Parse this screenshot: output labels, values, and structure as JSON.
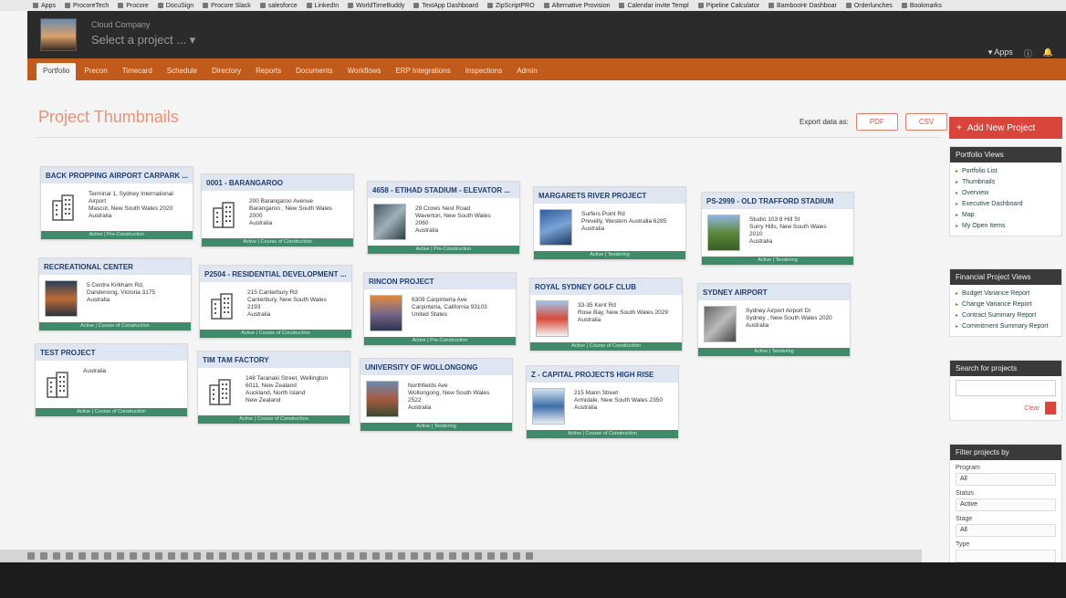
{
  "browser": {
    "bookmarks": [
      "Apps",
      "ProcoreTech",
      "Procore",
      "DocuSign",
      "Procore Slack",
      "salesforce",
      "LinkedIn",
      "WorldTimeBuddy",
      "TextApp Dashboard",
      "ZipScriptPRO",
      "Alternative Provision",
      "Calendar invite Templ",
      "Pipeline Calculator",
      "BambooHr Dashboar",
      "Orderlunches",
      "Bookmarks"
    ]
  },
  "header": {
    "company": "Cloud Company",
    "project_select": "Select a project ... ▾",
    "apps_label": "▾ Apps"
  },
  "nav": {
    "tabs": [
      "Portfolio",
      "Precon",
      "Timecard",
      "Schedule",
      "Directory",
      "Reports",
      "Documents",
      "Workflows",
      "ERP Integrations",
      "Inspections",
      "Admin"
    ]
  },
  "main": {
    "title": "Project Thumbnails",
    "export_label": "Export data as:",
    "export_pdf": "PDF",
    "export_csv": "CSV"
  },
  "projects": [
    {
      "name": "BACK PROPPING AIRPORT CARPARK ...",
      "address": [
        "Terminal 1, Sydney International",
        "Airport",
        "Mascot, New South Wales 2020",
        "Australia"
      ],
      "status": "Active | Pre-Construction",
      "thumb": "icon"
    },
    {
      "name": "0001 - BARANGAROO",
      "address": [
        "200 Barangaroo Avenue",
        "Barangaroo , New South Wales",
        "2000",
        "Australia"
      ],
      "status": "Active | Course of Construction",
      "thumb": "icon"
    },
    {
      "name": "4658 - ETIHAD STADIUM - ELEVATOR ...",
      "address": [
        "29 Crows Nest Road",
        "Waverton, New South Wales",
        "2060",
        "Australia"
      ],
      "status": "Active | Pre-Construction",
      "thumb": "photo"
    },
    {
      "name": "MARGARETS RIVER PROJECT",
      "address": [
        "Surfers Point Rd",
        "Prevelly, Western Australia 6285",
        "Australia"
      ],
      "status": "Active | Tendering",
      "thumb": "photo"
    },
    {
      "name": "PS-2999 - OLD TRAFFORD STADIUM",
      "address": [
        "Studio 103 8 Hill St",
        "Surry Hills, New South Wales",
        "2010",
        "Australia"
      ],
      "status": "Active | Tendering",
      "thumb": "photo"
    },
    {
      "name": "RECREATIONAL CENTER",
      "address": [
        "5 Centre Kirkham Rd,",
        "Dandenong, Victoria 3175",
        "Australia"
      ],
      "status": "Active | Course of Construction",
      "thumb": "photo"
    },
    {
      "name": "P2504 - RESIDENTIAL DEVELOPMENT ...",
      "address": [
        "215 Canterbury Rd",
        "Canterbury, New South Wales",
        "2193",
        "Australia"
      ],
      "status": "Active | Course of Construction",
      "thumb": "icon"
    },
    {
      "name": "RINCON PROJECT",
      "address": [
        "6309 Carpinteria Ave",
        "Carpinteria, California 93103",
        "United States"
      ],
      "status": "Active | Pre-Construction",
      "thumb": "photo"
    },
    {
      "name": "ROYAL SYDNEY GOLF CLUB",
      "address": [
        "33-35 Kent Rd",
        "Rose Bay, New South Wales 2029",
        "Australia"
      ],
      "status": "Active | Course of Construction",
      "thumb": "photo"
    },
    {
      "name": "SYDNEY AIRPORT",
      "address": [
        "Sydney Airport Airport Dr",
        "Sydney , New South Wales 2020",
        "Australia"
      ],
      "status": "Active | Tendering",
      "thumb": "photo"
    },
    {
      "name": "TEST PROJECT",
      "address": [
        "Australia"
      ],
      "status": "Active | Course of Construction",
      "thumb": "icon"
    },
    {
      "name": "TIM TAM FACTORY",
      "address": [
        "148 Taranaki Street, Wellington",
        "6011, New Zealand",
        "Auckland, North Island",
        "New Zealand"
      ],
      "status": "Active | Course of Construction",
      "thumb": "icon"
    },
    {
      "name": "UNIVERSITY OF WOLLONGONG",
      "address": [
        "Northfields Ave",
        "Wollongong, New South Wales",
        "2522",
        "Australia"
      ],
      "status": "Active | Tendering",
      "thumb": "photo"
    },
    {
      "name": "Z - CAPITAL PROJECTS HIGH RISE",
      "address": [
        "215 Mann Street",
        "Armidale, New South Wales 2350",
        "Australia"
      ],
      "status": "Active | Course of Construction",
      "thumb": "photo"
    }
  ],
  "sidebar": {
    "add_button": "Add New Project",
    "portfolio_head": "Portfolio Views",
    "portfolio_items": [
      "Portfolio List",
      "Thumbnails",
      "Overview",
      "Executive Dashboard",
      "Map",
      "My Open Items"
    ],
    "financial_head": "Financial Project Views",
    "financial_items": [
      "Budget Variance Report",
      "Change Variance Report",
      "Contract Summary Report",
      "Commitment Summary Report"
    ],
    "search_head": "Search for projects",
    "clear_label": "Clear",
    "filter_head": "Filter projects by",
    "filters": [
      {
        "label": "Program",
        "value": "All"
      },
      {
        "label": "Status",
        "value": "Active"
      },
      {
        "label": "Stage",
        "value": "All"
      },
      {
        "label": "Type",
        "value": ""
      }
    ]
  }
}
